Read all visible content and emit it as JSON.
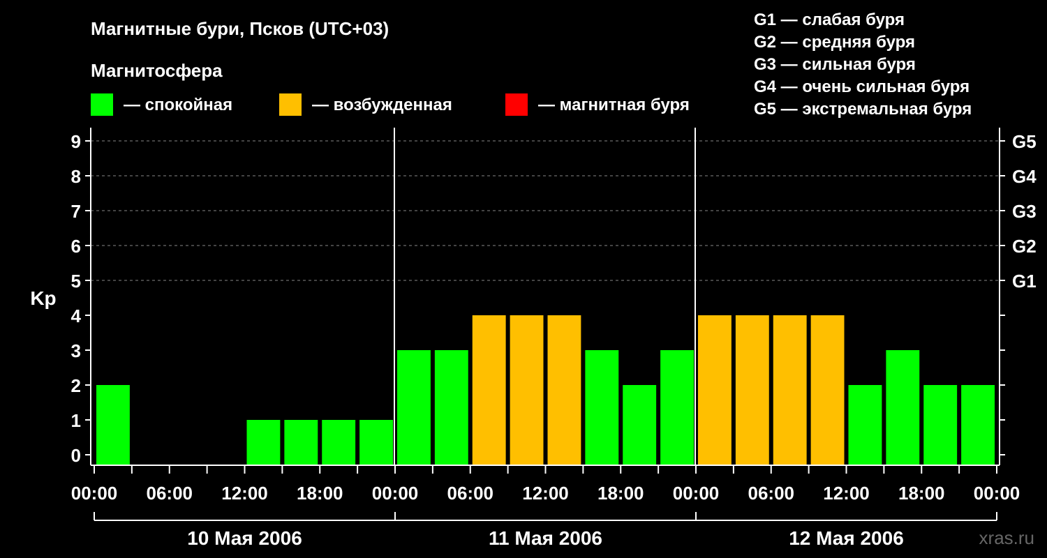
{
  "chart_data": {
    "type": "bar",
    "title": "Магнитные бури, Псков (UTC+03)",
    "legend_title": "Магнитосфера",
    "legend": [
      {
        "label": "— спокойная",
        "color": "#00ff00"
      },
      {
        "label": "— возбужденная",
        "color": "#ffbf00"
      },
      {
        "label": "— магнитная буря",
        "color": "#ff0000"
      }
    ],
    "storm_scale": [
      "G1 — слабая буря",
      "G2 — средняя буря",
      "G3 — сильная буря",
      "G4 — очень сильная буря",
      "G5 — экстремальная буря"
    ],
    "ylabel": "Kp",
    "ylim": [
      0,
      9
    ],
    "y_ticks": [
      "0",
      "1",
      "2",
      "3",
      "4",
      "5",
      "6",
      "7",
      "8",
      "9"
    ],
    "right_ticks": [
      {
        "kp": 5,
        "label": "G1"
      },
      {
        "kp": 6,
        "label": "G2"
      },
      {
        "kp": 7,
        "label": "G3"
      },
      {
        "kp": 8,
        "label": "G4"
      },
      {
        "kp": 9,
        "label": "G5"
      }
    ],
    "x_ticks": [
      "00:00",
      "06:00",
      "12:00",
      "18:00",
      "00:00",
      "06:00",
      "12:00",
      "18:00",
      "00:00",
      "06:00",
      "12:00",
      "18:00",
      "00:00"
    ],
    "days": [
      "10 Мая 2006",
      "11 Мая 2006",
      "12 Мая 2006"
    ],
    "interval_hours": 3,
    "values": [
      2,
      0,
      0,
      0,
      1,
      1,
      1,
      1,
      3,
      3,
      4,
      4,
      4,
      3,
      2,
      3,
      4,
      4,
      4,
      4,
      2,
      3,
      2,
      2
    ],
    "categories": [
      "quiet",
      "quiet",
      "quiet",
      "quiet",
      "quiet",
      "quiet",
      "quiet",
      "quiet",
      "quiet",
      "quiet",
      "active",
      "active",
      "active",
      "quiet",
      "quiet",
      "quiet",
      "active",
      "active",
      "active",
      "active",
      "quiet",
      "quiet",
      "quiet",
      "quiet"
    ],
    "category_colors": {
      "quiet": "#00ff00",
      "active": "#ffbf00",
      "storm": "#ff0000"
    },
    "grid": "dashed at Kp 5–9"
  },
  "watermark": "xras.ru"
}
